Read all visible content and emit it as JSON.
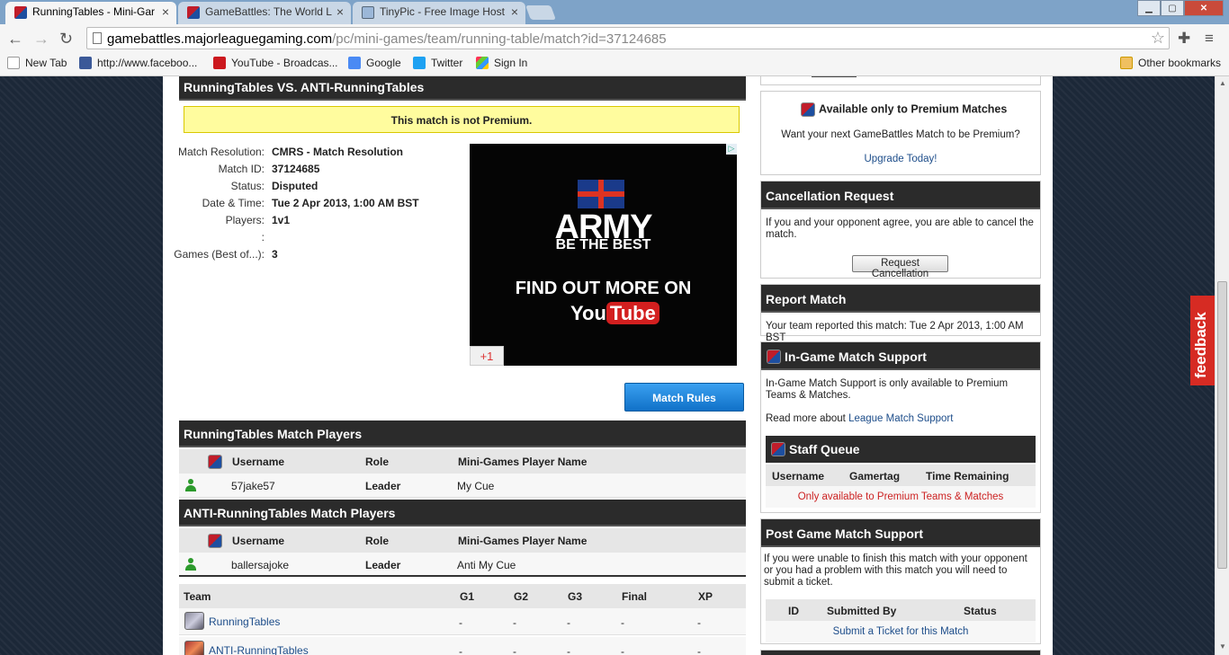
{
  "browser": {
    "tabs": [
      {
        "title": "RunningTables - Mini-Gar",
        "active": true
      },
      {
        "title": "GameBattles: The World L",
        "active": false
      },
      {
        "title": "TinyPic - Free Image Host",
        "active": false
      }
    ],
    "tab_close_glyph": "×",
    "url_host": "gamebattles.majorleaguegaming.com",
    "url_path": "/pc/mini-games/team/running-table/match?id=37124685",
    "bookmarks": [
      {
        "label": "New Tab",
        "icon": "page-icon",
        "color": "#ffffff"
      },
      {
        "label": "http://www.faceboo...",
        "icon": "facebook-icon",
        "color": "#3b5998"
      },
      {
        "label": "YouTube - Broadcas...",
        "icon": "youtube-icon",
        "color": "#cc181e"
      },
      {
        "label": "Google",
        "icon": "google-icon",
        "color": "#4a8af4"
      },
      {
        "label": "Twitter",
        "icon": "twitter-icon",
        "color": "#1da1f2"
      },
      {
        "label": "Sign In",
        "icon": "windows-icon",
        "color": "#f0a030"
      }
    ],
    "other_bookmarks": "Other bookmarks"
  },
  "match": {
    "title": "RunningTables VS. ANTI-RunningTables",
    "premium_notice": "This match is not Premium.",
    "details": [
      {
        "label": "Match Resolution:",
        "value": "CMRS - Match Resolution"
      },
      {
        "label": "Match ID:",
        "value": "37124685"
      },
      {
        "label": "Status:",
        "value": "Disputed"
      },
      {
        "label": "Date & Time:",
        "value": "Tue 2 Apr 2013, 1:00 AM BST"
      },
      {
        "label": "Players:",
        "value": "1v1"
      },
      {
        "label": ":",
        "value": ""
      },
      {
        "label": "Games (Best of...):",
        "value": "3"
      }
    ],
    "rules_button": "Match Rules"
  },
  "ad": {
    "headline": "ARMY",
    "tagline": "BE THE BEST",
    "cta": "FIND OUT MORE ON",
    "brand_you": "You",
    "brand_tube": "Tube",
    "plus_one": "+1"
  },
  "players_tables": [
    {
      "title": "RunningTables Match Players",
      "columns": [
        "Username",
        "Role",
        "Mini-Games Player Name"
      ],
      "rows": [
        {
          "username": "57jake57",
          "role": "Leader",
          "player_name": "My Cue"
        }
      ]
    },
    {
      "title": "ANTI-RunningTables Match Players",
      "columns": [
        "Username",
        "Role",
        "Mini-Games Player Name"
      ],
      "rows": [
        {
          "username": "ballersajoke",
          "role": "Leader",
          "player_name": "Anti My Cue"
        }
      ]
    }
  ],
  "results_table": {
    "columns": [
      "Team",
      "G1",
      "G2",
      "G3",
      "Final",
      "XP"
    ],
    "rows": [
      {
        "team": "RunningTables",
        "values": [
          "-",
          "-",
          "-",
          "-",
          "-"
        ]
      },
      {
        "team": "ANTI-RunningTables",
        "values": [
          "-",
          "-",
          "-",
          "-",
          "-"
        ]
      }
    ]
  },
  "sidebar": {
    "premium_only": {
      "title": "Available only to Premium Matches",
      "text": "Want your next GameBattles Match to be Premium?",
      "link": "Upgrade Today!"
    },
    "cancellation": {
      "title": "Cancellation Request",
      "text": "If you and your opponent agree, you are able to cancel the match.",
      "button": "Request Cancellation"
    },
    "report": {
      "title": "Report Match",
      "text": "Your team reported this match: Tue 2 Apr 2013, 1:00 AM BST"
    },
    "ingame_support": {
      "title": "In-Game Match Support",
      "text": "In-Game Match Support is only available to Premium Teams & Matches.",
      "read_more": "Read more about",
      "read_more_link": "League Match Support"
    },
    "staff_queue": {
      "title": "Staff Queue",
      "columns": [
        "Username",
        "Gamertag",
        "Time Remaining"
      ],
      "notice": "Only available to Premium Teams & Matches"
    },
    "post_game": {
      "title": "Post Game Match Support",
      "text": "If you were unable to finish this match with your opponent or you had a problem with this match you will need to submit a ticket.",
      "columns": [
        "ID",
        "Submitted By",
        "Status"
      ],
      "link": "Submit a Ticket for this Match"
    }
  },
  "feedback_tab": "feedback"
}
